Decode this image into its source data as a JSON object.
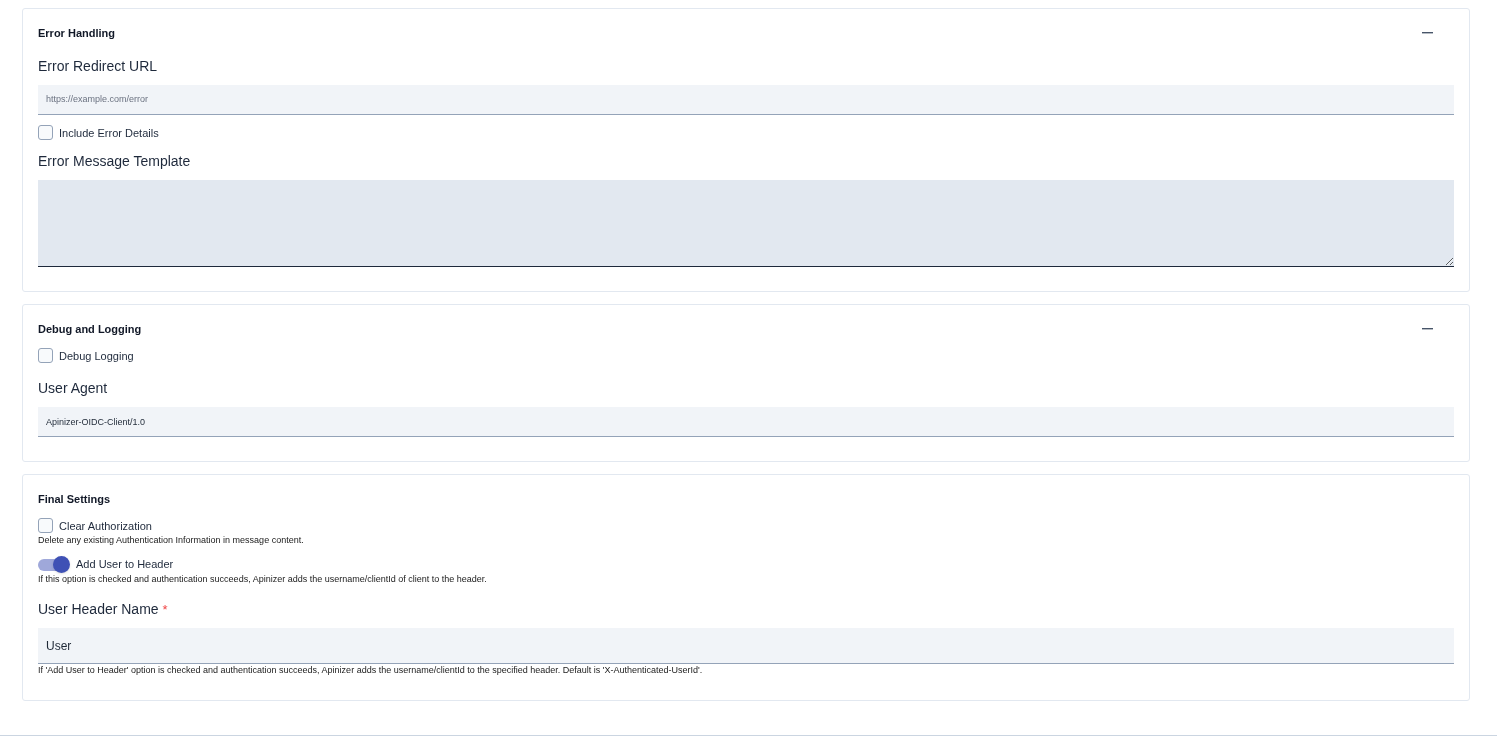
{
  "sections": [
    {
      "title": "Error Handling",
      "expanded": true,
      "items": [
        {
          "kind": "text_field",
          "label": "Error Redirect URL",
          "placeholder": "https://example.com/error"
        },
        {
          "kind": "checkbox",
          "label": "Include Error Details",
          "checked": false
        },
        {
          "kind": "textarea",
          "label": "Error Message Template"
        }
      ]
    },
    {
      "title": "Debug and Logging",
      "expanded": true,
      "items": [
        {
          "kind": "checkbox",
          "label": "Debug Logging",
          "checked": false
        },
        {
          "kind": "text_field",
          "label": "User Agent",
          "value": "Apinizer-OIDC-Client/1.0"
        }
      ]
    },
    {
      "title": "Final Settings",
      "items": [
        {
          "kind": "checkbox",
          "label": "Clear Authorization",
          "checked": false,
          "help": "Delete any existing Authentication Information in message content."
        },
        {
          "kind": "toggle",
          "label": "Add User to Header",
          "on": true,
          "help": "If this option is checked and authentication succeeds, Apinizer adds the username/clientId of client to the header."
        },
        {
          "kind": "text_field",
          "label": "User Header Name",
          "required_mark": "*",
          "value": "User",
          "large": true,
          "help": "If 'Add User to Header' option is checked and authentication succeeds, Apinizer adds the username/clientId to the specified header. Default is 'X-Authenticated-UserId'."
        }
      ]
    }
  ]
}
